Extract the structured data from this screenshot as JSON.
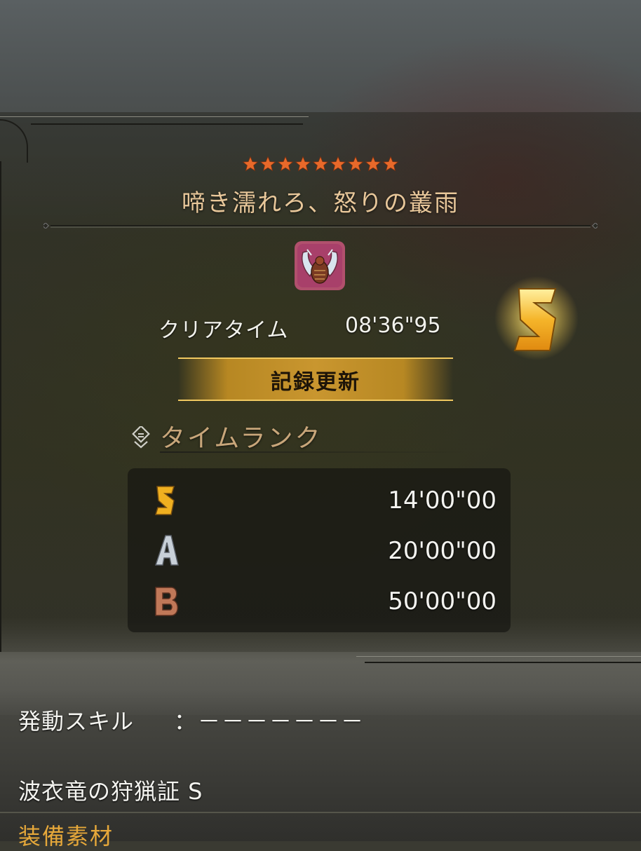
{
  "quest": {
    "star_count": 9,
    "star_color": "#e8692a",
    "title": "啼き濡れろ、怒りの叢雨"
  },
  "monster": {
    "icon": "monster-icon"
  },
  "clear_time": {
    "label": "クリアタイム",
    "value": "08'36\"95",
    "rank": "S"
  },
  "record": {
    "label": "記録更新"
  },
  "time_rank": {
    "title": "タイムランク",
    "rows": [
      {
        "rank": "S",
        "time": "14'00\"00",
        "color": "#f0b020"
      },
      {
        "rank": "A",
        "time": "20'00\"00",
        "color": "#c8d0d8"
      },
      {
        "rank": "B",
        "time": "50'00\"00",
        "color": "#c07858"
      }
    ]
  },
  "skills": {
    "label": "発動スキル",
    "value": "：－－－－－－－"
  },
  "certificate": "波衣竜の狩猟証 S",
  "materials_label": "装備素材"
}
